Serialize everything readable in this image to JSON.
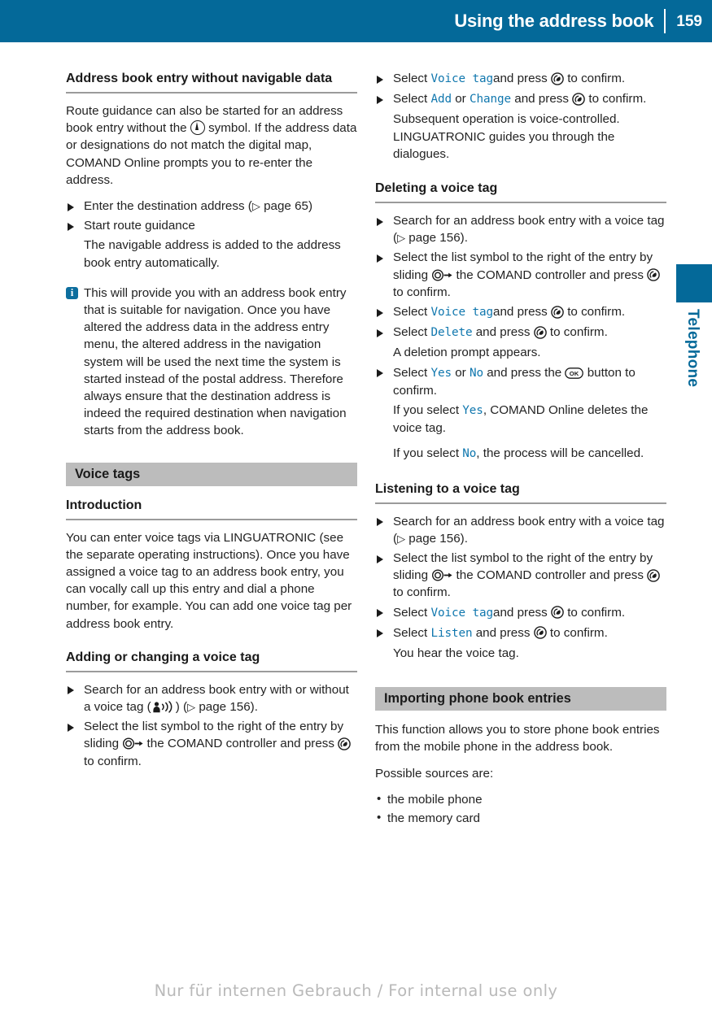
{
  "header": {
    "title": "Using the address book",
    "page_number": "159",
    "accent_color": "#046999"
  },
  "side_tab": {
    "label": "Telephone",
    "color": "#046999"
  },
  "left_column": {
    "heading": "Address book entry without navigable data",
    "intro_p1": "Route guidance can also be started for an address book entry without the",
    "intro_p2": "symbol. If the address data or designations do not match the digital map, COMAND Online prompts you to re-enter the address.",
    "step1_a": "Enter the destination address (",
    "step1_b": "page 65)",
    "step2": "Start route guidance",
    "step2_cont": "The navigable address is added to the address book entry automatically.",
    "note": "This will provide you with an address book entry that is suitable for navigation. Once you have altered the address data in the address entry menu, the altered address in the navigation system will be used the next time the system is started instead of the postal address. Therefore always ensure that the destination address is indeed the required destination when navigation starts from the address book.",
    "section_voice_tags": "Voice tags",
    "heading_introduction": "Introduction",
    "introduction_text": "You can enter voice tags via LINGUATRONIC (see the separate operating instructions). Once you have assigned a voice tag to an address book entry, you can vocally call up this entry and dial a phone number, for example. You can add one voice tag per address book entry.",
    "heading_adding": "Adding or changing a voice tag",
    "add_step1_a": "Search for an address book entry with or without a voice tag (",
    "add_step1_b": ") (",
    "add_step1_c": "page 156).",
    "add_step2_a": "Select the list symbol to the right of the entry by sliding",
    "add_step2_b": "the COMAND controller and press",
    "add_step2_c": "to confirm."
  },
  "right_column": {
    "step1_a": "Select",
    "step1_cmd": "Voice tag",
    "step1_b": "and press",
    "step1_c": "to confirm.",
    "step2_a": "Select",
    "step2_cmd1": "Add",
    "step2_or": "or",
    "step2_cmd2": "Change",
    "step2_b": "and press",
    "step2_c": "to confirm.",
    "step2_cont1": "Subsequent operation is voice-controlled. LINGUATRONIC guides you through the dialogues.",
    "heading_deleting": "Deleting a voice tag",
    "del_step1_a": "Search for an address book entry with a voice tag (",
    "del_step1_b": "page 156).",
    "del_step2_a": "Select the list symbol to the right of the entry by sliding",
    "del_step2_b": "the COMAND controller and press",
    "del_step2_c": "to confirm.",
    "del_step3_a": "Select",
    "del_step3_cmd": "Voice tag",
    "del_step3_b": "and press",
    "del_step3_c": "to confirm.",
    "del_step4_a": "Select",
    "del_step4_cmd": "Delete",
    "del_step4_b": "and press",
    "del_step4_c": "to confirm.",
    "del_step4_cont": "A deletion prompt appears.",
    "del_step5_a": "Select",
    "del_step5_cmd1": "Yes",
    "del_step5_or": "or",
    "del_step5_cmd2": "No",
    "del_step5_b": "and press the",
    "del_step5_c": "button to confirm.",
    "del_step5_cont1_a": "If you select",
    "del_step5_cont1_cmd": "Yes",
    "del_step5_cont1_b": ", COMAND Online deletes the voice tag.",
    "del_step5_cont2_a": "If you select",
    "del_step5_cont2_cmd": "No",
    "del_step5_cont2_b": ", the process will be cancelled.",
    "heading_listening": "Listening to a voice tag",
    "lis_step1_a": "Search for an address book entry with a voice tag (",
    "lis_step1_b": "page 156).",
    "lis_step2_a": "Select the list symbol to the right of the entry by sliding",
    "lis_step2_b": "the COMAND controller and press",
    "lis_step2_c": "to confirm.",
    "lis_step3_a": "Select",
    "lis_step3_cmd": "Voice tag",
    "lis_step3_b": "and press",
    "lis_step3_c": "to confirm.",
    "lis_step4_a": "Select",
    "lis_step4_cmd": "Listen",
    "lis_step4_b": "and press",
    "lis_step4_c": "to confirm.",
    "lis_step4_cont": "You hear the voice tag.",
    "section_importing": "Importing phone book entries",
    "importing_text": "This function allows you to store phone book entries from the mobile phone in the address book.",
    "sources_label": "Possible sources are:",
    "source_1": "the mobile phone",
    "source_2": "the memory card"
  },
  "footer": {
    "watermark": "Nur für internen Gebrauch / For internal use only"
  }
}
